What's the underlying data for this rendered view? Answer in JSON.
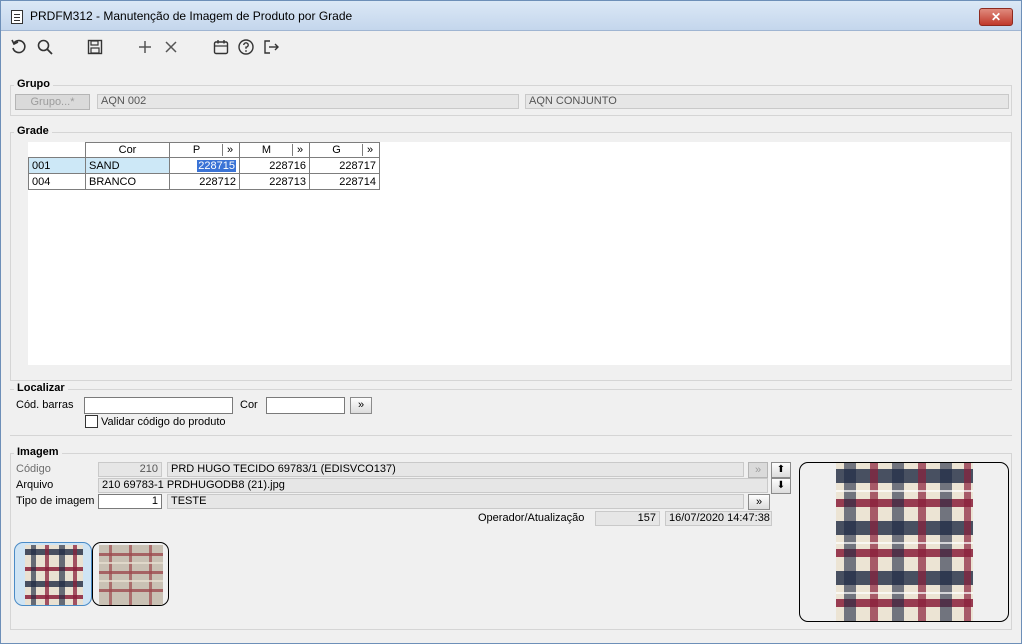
{
  "window": {
    "title": "PRDFM312 - Manutenção de Imagem de Produto por Grade",
    "close_label": "✕"
  },
  "toolbar": {
    "icons": [
      "refresh-icon",
      "search-icon",
      "save-icon",
      "add-icon",
      "delete-icon",
      "calendar-icon",
      "help-icon",
      "exit-icon"
    ]
  },
  "grupo": {
    "legend": "Grupo",
    "button_label": "Grupo...*",
    "code": "AQN 002",
    "description": "AQN CONJUNTO"
  },
  "grade": {
    "legend": "Grade",
    "headers": {
      "cor": "Cor",
      "p": "P",
      "m": "M",
      "g": "G",
      "more": "»"
    },
    "rows": [
      {
        "code": "001",
        "color": "SAND",
        "p": "228715",
        "m": "228716",
        "g": "228717"
      },
      {
        "code": "004",
        "color": "BRANCO",
        "p": "228712",
        "m": "228713",
        "g": "228714"
      }
    ]
  },
  "localizar": {
    "legend": "Localizar",
    "barcode_label": "Cód. barras",
    "barcode_value": "",
    "cor_label": "Cor",
    "cor_value": "",
    "search_button": "»",
    "validate_label": "Validar código do produto",
    "validate_checked": false
  },
  "imagem": {
    "legend": "Imagem",
    "codigo_label": "Código",
    "codigo_value": "210",
    "codigo_desc": "PRD HUGO TECIDO 69783/1 (EDISVCO137)",
    "arquivo_label": "Arquivo",
    "arquivo_value": "210 69783-1 PRDHUGODB8 (21).jpg",
    "tipo_label": "Tipo de imagem",
    "tipo_value": "1",
    "tipo_desc": "TESTE",
    "operador_label": "Operador/Atualização",
    "operador_value": "157",
    "updated_at": "16/07/2020 14:47:38",
    "more_button": "»",
    "up_button": "⬆",
    "down_button": "⬇"
  },
  "colors": {
    "selection": "#3a73d6",
    "row_highlight": "#cde8f7",
    "plaid_red": "#8a1f3a",
    "plaid_navy": "#1f2a44"
  }
}
